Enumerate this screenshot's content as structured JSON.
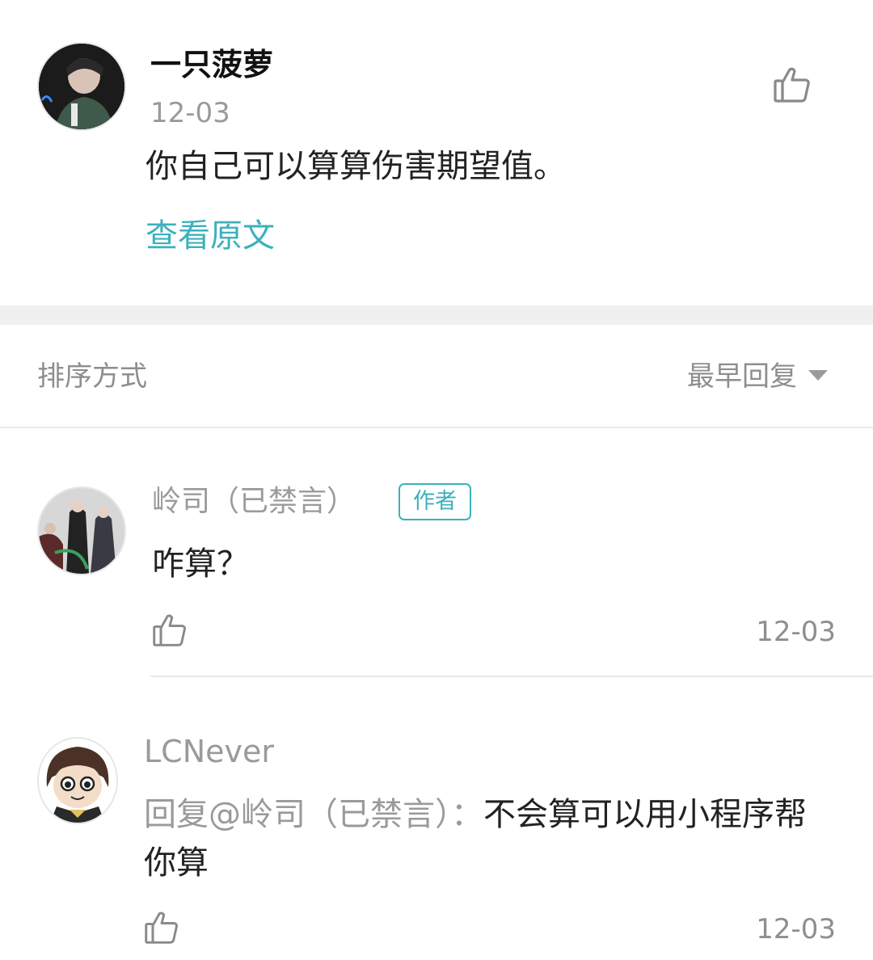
{
  "top_comment": {
    "username": "一只菠萝",
    "date": "12-03",
    "text": "你自己可以算算伤害期望值。",
    "view_original": "查看原文",
    "like_icon": "thumbs-up-icon"
  },
  "sort_bar": {
    "label": "排序方式",
    "selected": "最早回复",
    "dropdown_icon": "caret-down-icon"
  },
  "replies": [
    {
      "username": "岭司（已禁言）",
      "badge": "作者",
      "text": "咋算？",
      "date": "12-03",
      "like_icon": "thumbs-up-icon"
    },
    {
      "username": "LCNever",
      "mention": "回复@岭司（已禁言）：",
      "text": "不会算可以用小程序帮你算",
      "date": "12-03",
      "like_icon": "thumbs-up-icon"
    }
  ],
  "colors": {
    "accent": "#3bb1bd",
    "muted_text": "#9a9a9a",
    "section_gap": "#f0f0f0"
  }
}
